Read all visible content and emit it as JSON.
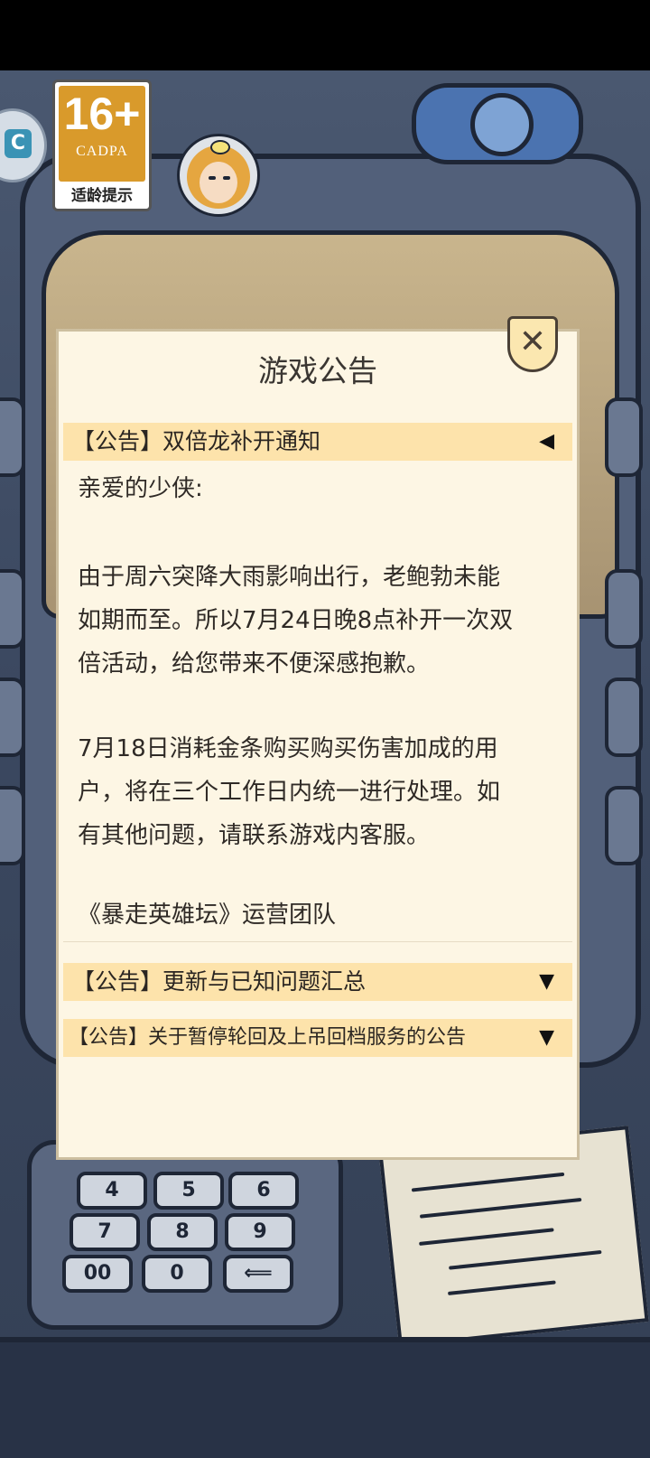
{
  "age_rating": {
    "age": "16+",
    "org": "CADPA",
    "tip": "适龄提示"
  },
  "left_icon": {
    "glyph": "C"
  },
  "dialog": {
    "title": "游戏公告",
    "close_glyph": "✕"
  },
  "announcements": [
    {
      "title": "【公告】双倍龙补开通知",
      "arrow": "◀",
      "expanded": true,
      "body": {
        "greeting": "亲爱的少侠:",
        "paragraph1_line1": "由于周六突降大雨影响出行，老鲍勃未能",
        "paragraph1_line2": "如期而至。所以7月24日晚8点补开一次双",
        "paragraph1_line3": "倍活动，给您带来不便深感抱歉。",
        "paragraph2_line1": "7月18日消耗金条购买购买伤害加成的用",
        "paragraph2_line2": "户，将在三个工作日内统一进行处理。如",
        "paragraph2_line3": "有其他问题，请联系游戏内客服。",
        "signature": "《暴走英雄坛》运营团队"
      }
    },
    {
      "title": "【公告】更新与已知问题汇总",
      "arrow": "▼",
      "expanded": false
    },
    {
      "title": "【公告】关于暂停轮回及上吊回档服务的公告",
      "arrow": "▼",
      "expanded": false
    }
  ],
  "keypad": {
    "keys": [
      "4",
      "5",
      "6",
      "7",
      "8",
      "9",
      "00",
      "0",
      "⟸"
    ]
  },
  "colors": {
    "dialog_bg": "#fdf6e4",
    "header_bg": "#fde3ab",
    "badge_orange": "#d99a2b"
  }
}
